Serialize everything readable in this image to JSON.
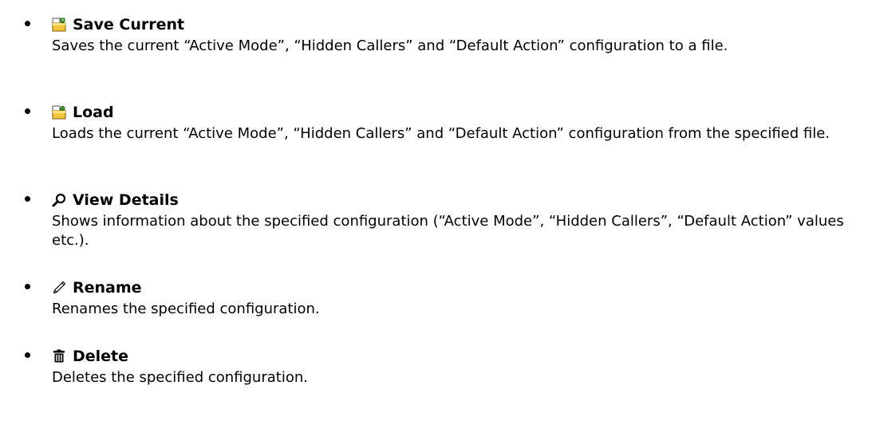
{
  "items": [
    {
      "icon": "save-folder-icon",
      "title": "Save Current",
      "description": "Saves the current “Active Mode”, “Hidden Callers” and “Default Action” configuration to a file."
    },
    {
      "icon": "load-folder-icon",
      "title": "Load",
      "description": "Loads the current “Active Mode”, “Hidden Callers” and “Default Action” configuration from the specified file."
    },
    {
      "icon": "magnifier-icon",
      "title": "View Details",
      "description": "Shows information about the specified configuration (“Active Mode”, “Hidden Callers”, “Default Action” values etc.)."
    },
    {
      "icon": "pencil-icon",
      "title": "Rename",
      "description": "Renames the specified configuration."
    },
    {
      "icon": "trash-icon",
      "title": "Delete",
      "description": "Deletes the specified configuration."
    }
  ]
}
